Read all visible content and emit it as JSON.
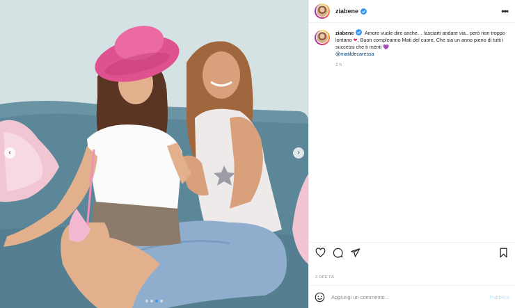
{
  "post": {
    "username": "ziabene",
    "verified": true,
    "more_icon": "more-horizontal-icon",
    "caption": {
      "username": "ziabene",
      "part1": "Amore vuole dire anche… lasciarti andare via.. però non troppo lontano",
      "heart": "❤",
      "part2": ". Buon compleanno Mati del cuore. Che sia un anno pieno di tutti i successi che ti meriti",
      "purple_heart": "💜",
      "mention": "@matildecaressa",
      "time": "2 h"
    },
    "actions": {
      "like_icon": "heart-icon",
      "comment_icon": "comment-icon",
      "share_icon": "send-icon",
      "save_icon": "bookmark-icon"
    },
    "date": "2 ORE FA",
    "comment": {
      "placeholder": "Aggiungi un commento...",
      "publish_label": "Pubblica"
    },
    "carousel": {
      "prev": "‹",
      "next": "›",
      "slide_count": 4,
      "active_slide": 3
    }
  },
  "colors": {
    "accent": "#3897f0",
    "publish_disabled": "#b2dffc",
    "mention": "#00376b",
    "muted": "#8e8e8e"
  }
}
